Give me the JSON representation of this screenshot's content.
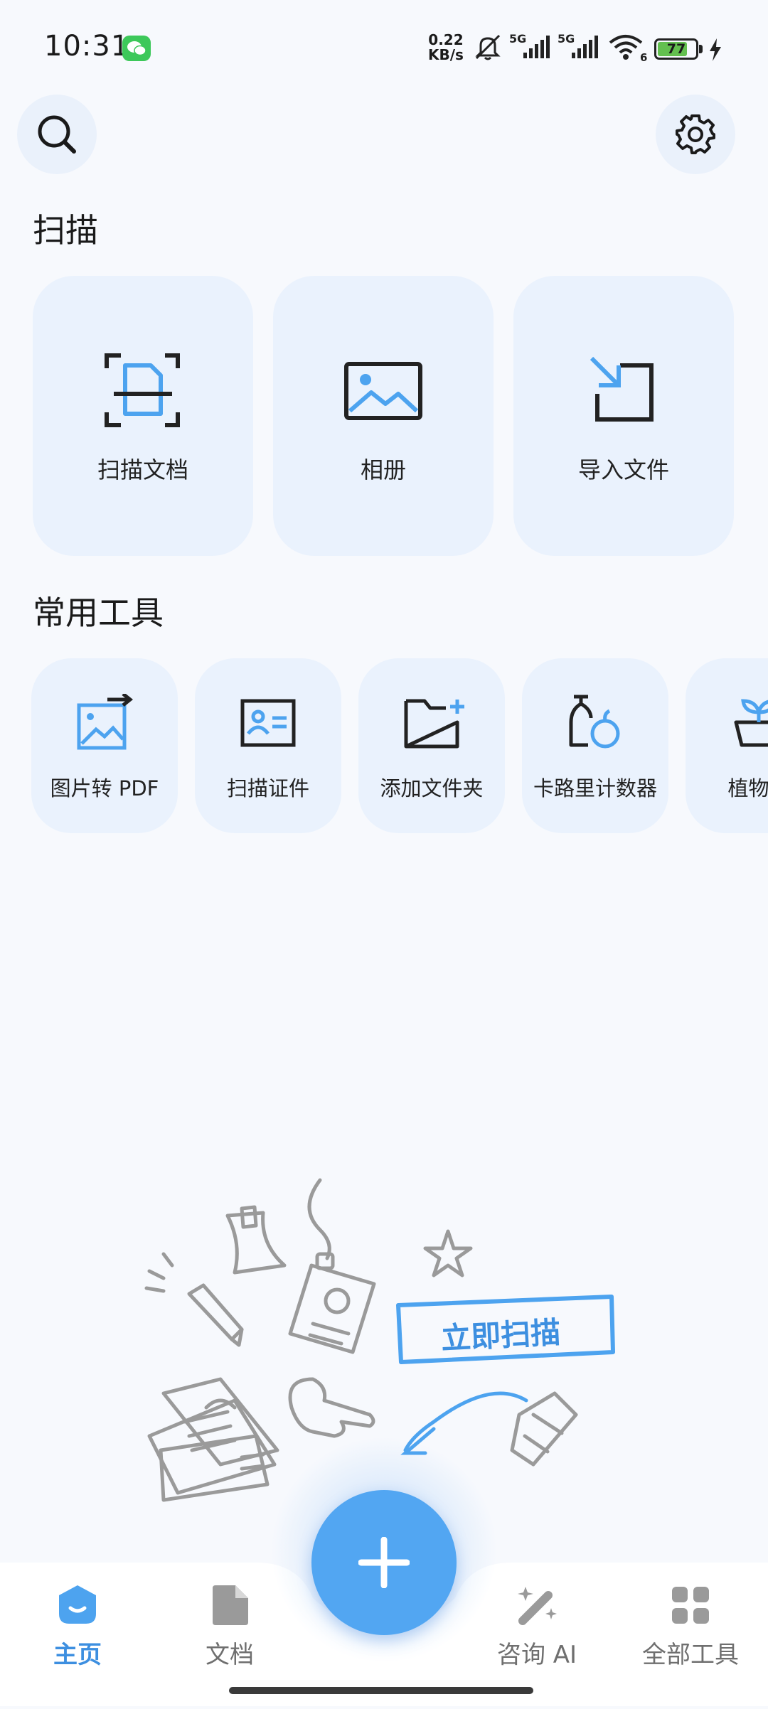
{
  "status_bar": {
    "time": "10:31",
    "net_speed_value": "0.22",
    "net_speed_unit": "KB/s",
    "signal_1_label": "5G",
    "signal_2_label": "5G",
    "wifi_label": "6",
    "battery_level": "77",
    "icons": [
      "wechat-icon",
      "mute-icon",
      "signal-icon",
      "wifi-icon",
      "battery-icon",
      "charging-icon"
    ]
  },
  "header": {
    "search_icon": "search-icon",
    "settings_icon": "gear-icon"
  },
  "scan_section": {
    "title": "扫描",
    "cards": [
      {
        "label": "扫描文档",
        "icon": "scan-document-icon"
      },
      {
        "label": "相册",
        "icon": "album-icon"
      },
      {
        "label": "导入文件",
        "icon": "import-icon"
      }
    ]
  },
  "tools_section": {
    "title": "常用工具",
    "items": [
      {
        "label": "图片转 PDF",
        "icon": "image-to-pdf-icon"
      },
      {
        "label": "扫描证件",
        "icon": "id-card-icon"
      },
      {
        "label": "添加文件夹",
        "icon": "add-folder-icon"
      },
      {
        "label": "卡路里计数器",
        "icon": "calorie-icon"
      },
      {
        "label": "植物扌",
        "icon": "plant-icon"
      }
    ]
  },
  "illustration": {
    "cta": "立即扫描"
  },
  "bottom_nav": {
    "items": [
      {
        "label": "主页",
        "icon": "home-icon",
        "active": true
      },
      {
        "label": "文档",
        "icon": "document-icon",
        "active": false
      },
      {
        "label": "咨询 AI",
        "icon": "ai-wand-icon",
        "active": false
      },
      {
        "label": "全部工具",
        "icon": "grid-icon",
        "active": false
      }
    ],
    "fab_icon": "plus-icon"
  },
  "colors": {
    "accent": "#52a6f2",
    "accent_text": "#3d8fe0",
    "card_bg": "#eaf2fd",
    "page_bg": "#f7f9fd"
  }
}
